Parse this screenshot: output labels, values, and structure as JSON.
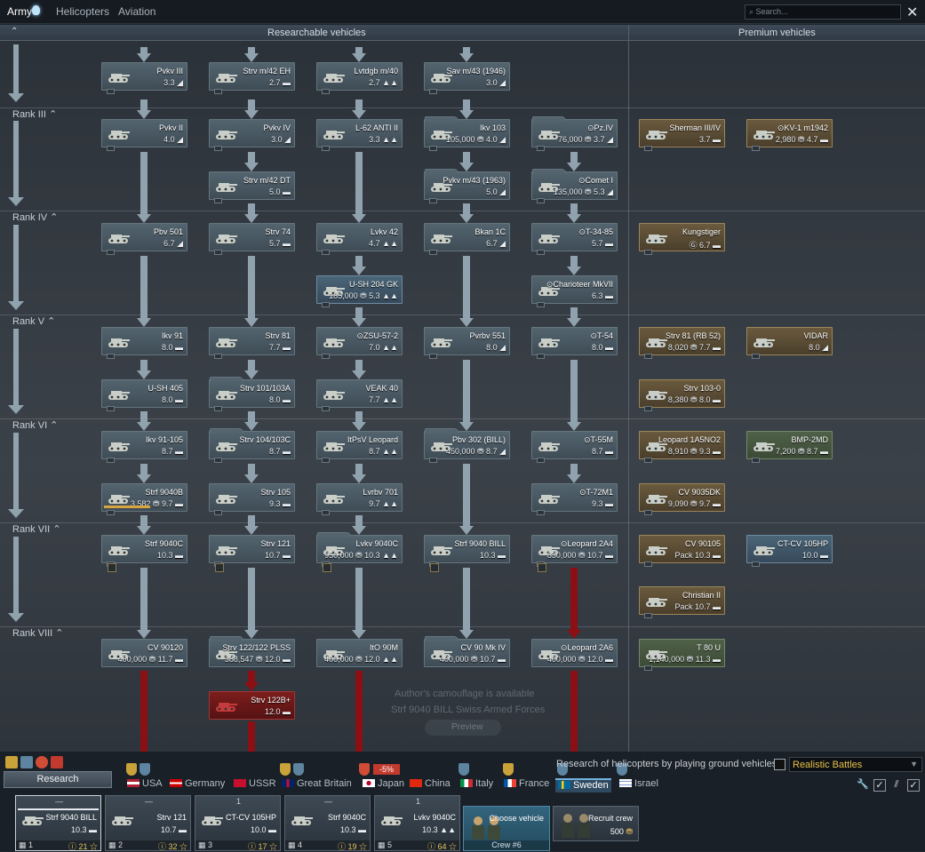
{
  "topbar": {
    "army": "Army",
    "helicopters": "Helicopters",
    "aviation": "Aviation",
    "search_placeholder": "Search...",
    "close": "✕"
  },
  "header": {
    "collapse": "⌃",
    "researchable": "Researchable vehicles",
    "premium": "Premium vehicles"
  },
  "ranks": [
    "Rank III ⌃",
    "Rank IV ⌃",
    "Rank V ⌃",
    "Rank VI ⌃",
    "Rank VII ⌃",
    "Rank VIII ⌃"
  ],
  "cards": [
    {
      "name": "Pvkv III",
      "br": "3.3 ◢"
    },
    {
      "name": "Strv m/42 EH",
      "br": "2.7 ▬"
    },
    {
      "name": "Lvtdgb m/40",
      "br": "2.7 ▲▲"
    },
    {
      "name": "Sav m/43 (1946)",
      "br": "3.0 ◢"
    },
    {
      "name": "Pvkv II",
      "br": "4.0 ◢"
    },
    {
      "name": "Pvkv IV",
      "br": "3.0 ◢"
    },
    {
      "name": "L-62 ANTI II",
      "br": "3.3 ▲▲"
    },
    {
      "name": "Ikv 103",
      "br": "105,000 ⛃ 4.0 ◢"
    },
    {
      "name": "⊙Pz.IV",
      "br": "76,000 ⛃ 3.7 ◢"
    },
    {
      "name": "Strv m/42 DT",
      "br": "5.0 ▬"
    },
    {
      "name": "Pvkv m/43 (1963)",
      "br": "5.0 ◢"
    },
    {
      "name": "⊙Comet I",
      "br": "135,000 ⛃ 5.3 ◢"
    },
    {
      "name": "Pbv 501",
      "br": "6.7 ◢"
    },
    {
      "name": "Strv 74",
      "br": "5.7 ▬"
    },
    {
      "name": "Lvkv 42",
      "br": "4.7 ▲▲"
    },
    {
      "name": "Bkan 1C",
      "br": "6.7 ◢"
    },
    {
      "name": "⊙T-34-85",
      "br": "5.7 ▬"
    },
    {
      "name": "U-SH 204 GK",
      "br": "185,000 ⛃ 5.3 ▲▲"
    },
    {
      "name": "⊙Charioteer MkVII",
      "br": "6.3 ▬"
    },
    {
      "name": "Ikv 91",
      "br": "8.0 ▬"
    },
    {
      "name": "Strv 81",
      "br": "7.7 ▬"
    },
    {
      "name": "⊙ZSU-57-2",
      "br": "7.0 ▲▲"
    },
    {
      "name": "Pvrbv 551",
      "br": "8.0 ◢"
    },
    {
      "name": "⊙T-54",
      "br": "8.0 ▬"
    },
    {
      "name": "U-SH 405",
      "br": "8.0 ▬"
    },
    {
      "name": "Strv 101/103A",
      "br": "8.0 ▬"
    },
    {
      "name": "VEAK 40",
      "br": "7.7 ▲▲"
    },
    {
      "name": "Ikv 91-105",
      "br": "8.7 ▬"
    },
    {
      "name": "Strv 104/103C",
      "br": "8.7 ▬"
    },
    {
      "name": "ItPsV Leopard",
      "br": "8.7 ▲▲"
    },
    {
      "name": "Pbv 302 (BILL)",
      "br": "450,000 ⛃ 8.7 ◢"
    },
    {
      "name": "⊙T-55M",
      "br": "8.7 ▬"
    },
    {
      "name": "Strf 9040B",
      "br": "3,582 ⛃ 9.7 ▬"
    },
    {
      "name": "Strv 105",
      "br": "9.3 ▬"
    },
    {
      "name": "Lvrbv 701",
      "br": "9.7 ▲▲"
    },
    {
      "name": "⊙T-72M1",
      "br": "9.3 ▬"
    },
    {
      "name": "Strf 9040C",
      "br": "10.3 ▬"
    },
    {
      "name": "Strv 121",
      "br": "10.7 ▬"
    },
    {
      "name": "Lvkv 9040C",
      "br": "950,000 ⛃ 10.3 ▲▲"
    },
    {
      "name": "Strf 9040 BILL",
      "br": "10.3 ▬"
    },
    {
      "name": "⊙Leopard 2A4",
      "br": "830,000 ⛃ 10.7 ▬"
    },
    {
      "name": "CV 90120",
      "br": "400,000 ⛃ 11.7 ▬"
    },
    {
      "name": "Strv 122/122 PLSS",
      "br": "388,547 ⛃ 12.0 ▬"
    },
    {
      "name": "ItO 90M",
      "br": "400,000 ⛃ 12.0 ▲▲"
    },
    {
      "name": "CV 90 Mk IV",
      "br": "400,000 ⛃ 10.7 ▬"
    },
    {
      "name": "⊙Leopard 2A6",
      "br": "400,000 ⛃ 12.0 ▬"
    },
    {
      "name": "Strv 122B+",
      "br": "12.0 ▬"
    }
  ],
  "premium": [
    {
      "name": "Sherman III/IV",
      "br": "3.7 ▬"
    },
    {
      "name": "⊙KV-1 m1942",
      "br": "2,980 ⛃ 4.7 ▬"
    },
    {
      "name": "Kungstiger",
      "br": "Ⓖ 6.7 ▬"
    },
    {
      "name": "Strv 81 (RB 52)",
      "br": "8,020 ⛃ 7.7 ▬"
    },
    {
      "name": "VIDAR",
      "br": "8.0 ◢"
    },
    {
      "name": "Strv 103-0",
      "br": "8,380 ⛃ 8.0 ▬"
    },
    {
      "name": "Leopard 1A5NO2",
      "br": "8,910 ⛃ 9.3 ▬"
    },
    {
      "name": "BMP-2MD",
      "br": "7,200 ⛃ 8.7 ▬"
    },
    {
      "name": "CV 9035DK",
      "br": "9,090 ⛃ 9.7 ▬"
    },
    {
      "name": "CV 90105",
      "br": "Pack 10.3 ▬"
    },
    {
      "name": "CT-CV 105HP",
      "br": "10.0 ▬"
    },
    {
      "name": "Christian II",
      "br": "Pack 10.7 ▬"
    },
    {
      "name": "T 80 U",
      "br": "1,140,000 ⛃ 11.3 ▬"
    }
  ],
  "camo": {
    "line1": "Author's camouflage is available",
    "line2": "Strf 9040 BILL Swiss Armed Forces",
    "preview": "Preview"
  },
  "research_btn": "Research",
  "discount": "-5%",
  "nations": [
    "USA",
    "Germany",
    "USSR",
    "Great Britain",
    "Japan",
    "China",
    "Italy",
    "France",
    "Sweden",
    "Israel"
  ],
  "heli_text": "Research of helicopters by playing ground vehicles",
  "mode": "Realistic Battles",
  "slots": [
    {
      "top": "—",
      "name": "Strf 9040 BILL",
      "br": "10.3 ▬",
      "num": "1",
      "xp": "21"
    },
    {
      "top": "—",
      "name": "Strv 121",
      "br": "10.7 ▬",
      "num": "2",
      "xp": "32"
    },
    {
      "top": "1",
      "name": "CT-CV 105HP",
      "br": "10.0 ▬",
      "num": "3",
      "xp": "17"
    },
    {
      "top": "—",
      "name": "Strf 9040C",
      "br": "10.3 ▬",
      "num": "4",
      "xp": "19"
    },
    {
      "top": "1",
      "name": "Lvkv 9040C",
      "br": "10.3 ▲▲",
      "num": "5",
      "xp": "64"
    }
  ],
  "choose": {
    "label": "Choose vehicle",
    "crew": "Crew #6"
  },
  "recruit": {
    "label": "Recruit crew",
    "price": "500"
  }
}
